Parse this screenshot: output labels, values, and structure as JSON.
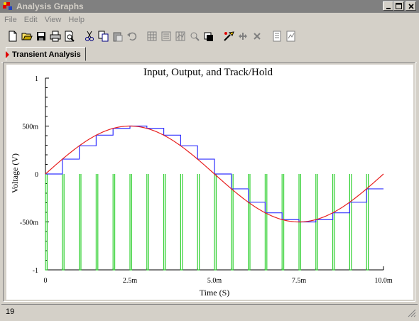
{
  "window": {
    "title": "Analysis Graphs"
  },
  "menu": [
    {
      "label": "File",
      "accel": "F"
    },
    {
      "label": "Edit",
      "accel": "E"
    },
    {
      "label": "View",
      "accel": "V"
    },
    {
      "label": "Help",
      "accel": "H"
    }
  ],
  "toolbar": {
    "buttons": [
      "new-icon",
      "open-icon",
      "save-icon",
      "print-icon",
      "print-preview-icon",
      "cut-icon",
      "copy-icon",
      "paste-icon",
      "undo-icon",
      "grid-icon",
      "legend-icon",
      "cursors-icon",
      "zoom-icon",
      "reverse-colors-icon",
      "properties-icon",
      "select-x-icon",
      "select-y-icon",
      "overlay-icon",
      "export-icon"
    ]
  },
  "tab": {
    "label": "Transient Analysis"
  },
  "status": {
    "text": "19"
  },
  "colors": {
    "input_signal": "#e82020",
    "track_hold": "#3030ff",
    "clock": "#30d030"
  },
  "chart_data": {
    "type": "line",
    "title": "Input, Output, and Track/Hold",
    "xlabel": "Time (S)",
    "ylabel": "Voltage (V)",
    "xlim": [
      0,
      0.01
    ],
    "ylim": [
      -1,
      1
    ],
    "x_ticks": [
      {
        "value": 0,
        "label": "0"
      },
      {
        "value": 0.0025,
        "label": "2.5m"
      },
      {
        "value": 0.005,
        "label": "5.0m"
      },
      {
        "value": 0.0075,
        "label": "7.5m"
      },
      {
        "value": 0.01,
        "label": "10.0m"
      }
    ],
    "y_ticks": [
      {
        "value": 1,
        "label": "1"
      },
      {
        "value": 0.5,
        "label": "500m"
      },
      {
        "value": 0,
        "label": "0"
      },
      {
        "value": -0.5,
        "label": "-500m"
      },
      {
        "value": -1,
        "label": "-1"
      }
    ],
    "grid": false,
    "series": [
      {
        "role": "input",
        "color": "#e82020",
        "function": "sine",
        "amplitude": 0.5,
        "frequency_hz": 100,
        "x_range": [
          0,
          0.01
        ]
      },
      {
        "role": "track_hold",
        "color": "#3030ff",
        "kind": "step",
        "step_times": [
          0,
          0.0005,
          0.001,
          0.0015,
          0.002,
          0.0025,
          0.003,
          0.0035,
          0.004,
          0.0045,
          0.005,
          0.0055,
          0.006,
          0.0065,
          0.007,
          0.0075,
          0.008,
          0.0085,
          0.009,
          0.0095,
          0.01
        ],
        "values": [
          0,
          0.155,
          0.294,
          0.405,
          0.476,
          0.5,
          0.476,
          0.405,
          0.294,
          0.155,
          0,
          -0.155,
          -0.294,
          -0.405,
          -0.476,
          -0.5,
          -0.476,
          -0.405,
          -0.294,
          -0.155
        ]
      },
      {
        "role": "clock",
        "color": "#30d030",
        "kind": "pulse",
        "pulse_times": [
          0,
          0.0005,
          0.001,
          0.0015,
          0.002,
          0.0025,
          0.003,
          0.0035,
          0.004,
          0.0045,
          0.005,
          0.0055,
          0.006,
          0.0065,
          0.007,
          0.0075,
          0.008,
          0.0085,
          0.009,
          0.0095
        ],
        "pulse_width": 5e-05,
        "high": 0,
        "low": -1
      }
    ]
  }
}
